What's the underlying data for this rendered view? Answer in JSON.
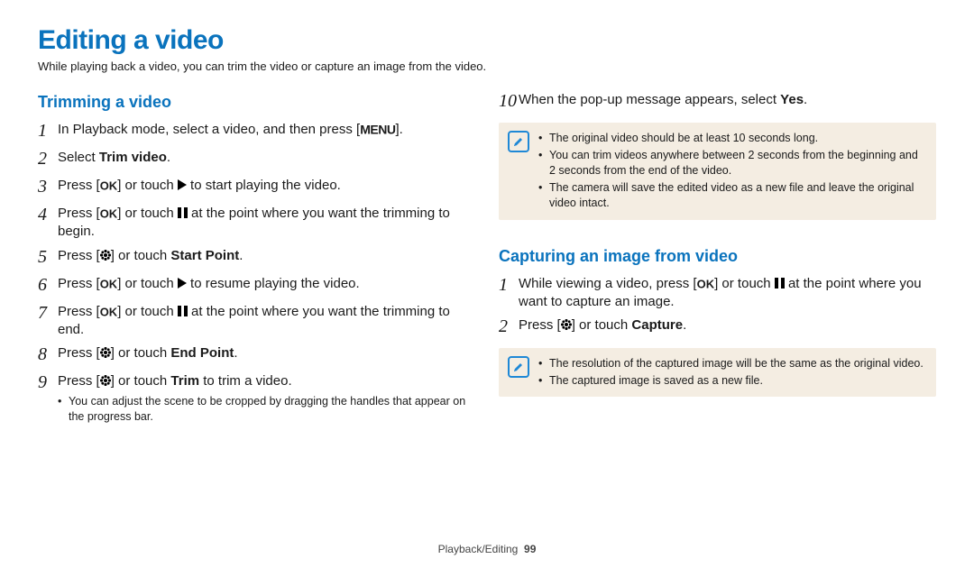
{
  "heading": "Editing a video",
  "intro": "While playing back a video, you can trim the video or capture an image from the video.",
  "trimming": {
    "heading": "Trimming a video",
    "steps": {
      "s1_pre": "In Playback mode, select a video, and then press [",
      "s1_post": "].",
      "s2_pre": "Select ",
      "s2_bold": "Trim video",
      "s2_post": ".",
      "s3_pre": "Press [",
      "s3_mid": "] or touch ",
      "s3_post": " to start playing the video.",
      "s4_pre": "Press [",
      "s4_mid": "] or touch ",
      "s4_post": " at the point where you want the trimming to begin.",
      "s5_pre": "Press [",
      "s5_mid": "] or touch ",
      "s5_bold": "Start Point",
      "s5_post": ".",
      "s6_pre": "Press [",
      "s6_mid": "] or touch ",
      "s6_post": " to resume playing the video.",
      "s7_pre": "Press [",
      "s7_mid": "] or touch ",
      "s7_post": " at the point where you want the trimming to end.",
      "s8_pre": "Press [",
      "s8_mid": "] or touch ",
      "s8_bold": "End Point",
      "s8_post": ".",
      "s9_pre": "Press [",
      "s9_mid": "] or touch ",
      "s9_bold": "Trim",
      "s9_post": " to trim a video.",
      "sub1": "You can adjust the scene to be cropped by dragging the handles that appear on the progress bar."
    }
  },
  "right": {
    "s10_pre": "When the pop-up message appears, select ",
    "s10_bold": "Yes",
    "s10_post": ".",
    "note1": [
      "The original video should be at least 10 seconds long.",
      "You can trim videos anywhere between 2 seconds from the beginning and 2 seconds from the end of the video.",
      "The camera will save the edited video as a new file and leave the original video intact."
    ]
  },
  "capturing": {
    "heading": "Capturing an image from video",
    "s1_pre": "While viewing a video, press [",
    "s1_mid": "] or touch ",
    "s1_post": " at the point where you want to capture an image.",
    "s2_pre": "Press [",
    "s2_mid": "] or touch ",
    "s2_bold": "Capture",
    "s2_post": ".",
    "note2": [
      "The resolution of the captured image will be the same as the original video.",
      "The captured image is saved as a new file."
    ]
  },
  "footer_section": "Playback/Editing",
  "footer_page": "99",
  "icons": {
    "menu": "MENU",
    "ok": "OK"
  }
}
